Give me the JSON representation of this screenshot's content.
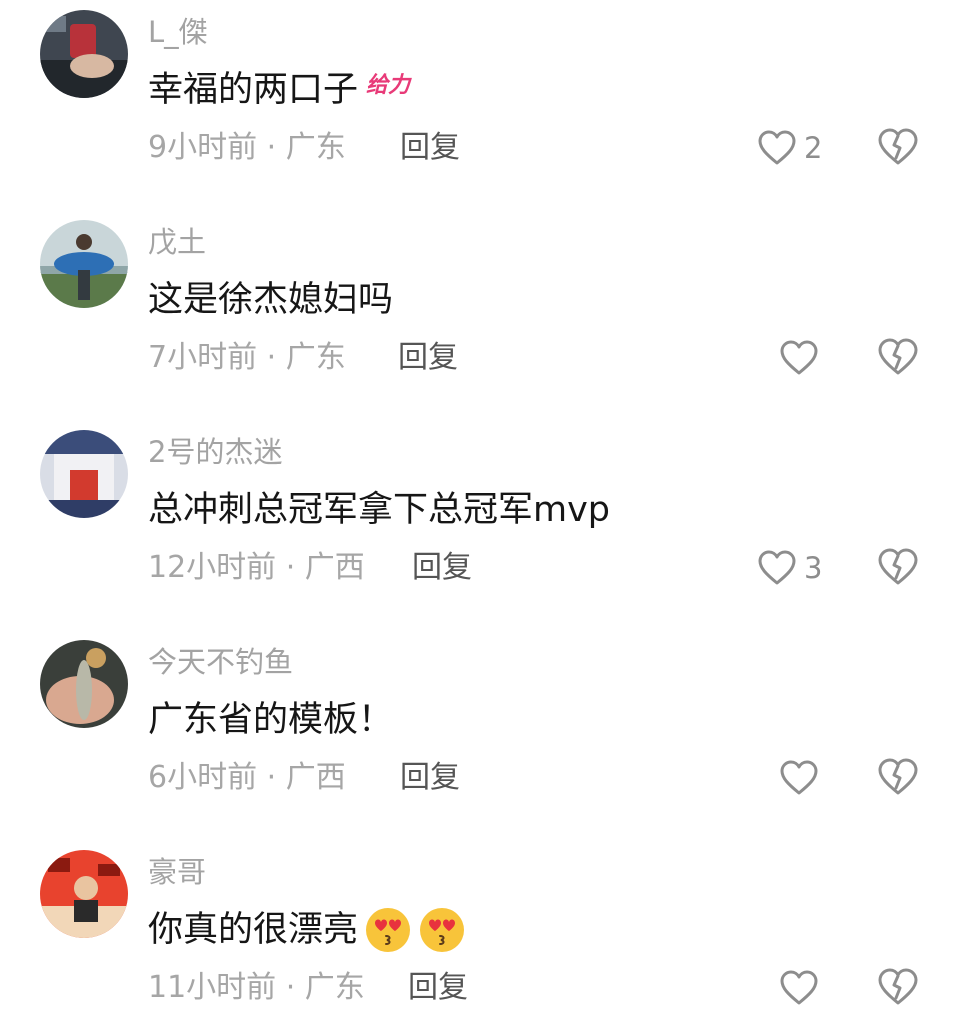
{
  "comments": [
    {
      "username": "L_傑",
      "text": "幸福的两口子",
      "sticker": "给力",
      "time_location": "9小时前 · 广东",
      "reply_label": "回复",
      "likes": "2",
      "avatar_icon": "car-photo-avatar"
    },
    {
      "username": "戊土",
      "text": "这是徐杰媳妇吗",
      "time_location": "7小时前 · 广东",
      "reply_label": "回复",
      "likes": "",
      "avatar_icon": "fish-catch-avatar"
    },
    {
      "username": "2号的杰迷",
      "text": "总冲刺总冠军拿下总冠军mvp",
      "time_location": "12小时前 · 广西",
      "reply_label": "回复",
      "likes": "3",
      "avatar_icon": "jersey-2-avatar"
    },
    {
      "username": "今天不钓鱼",
      "text": "广东省的模板！",
      "time_location": "6小时前 · 广西",
      "reply_label": "回复",
      "likes": "",
      "avatar_icon": "fish-in-hand-avatar"
    },
    {
      "username": "豪哥",
      "text": "你真的很漂亮",
      "emojis": [
        "heart-eyes-emoji",
        "heart-eyes-emoji"
      ],
      "time_location": "11小时前 · 广东",
      "reply_label": "回复",
      "likes": "",
      "avatar_icon": "fortune-poster-avatar"
    }
  ],
  "colors": {
    "username": "#a3a3a3",
    "text": "#161616",
    "meta": "#a6a6a6",
    "icon": "#8d8d8d",
    "sticker": "#e83a78"
  }
}
